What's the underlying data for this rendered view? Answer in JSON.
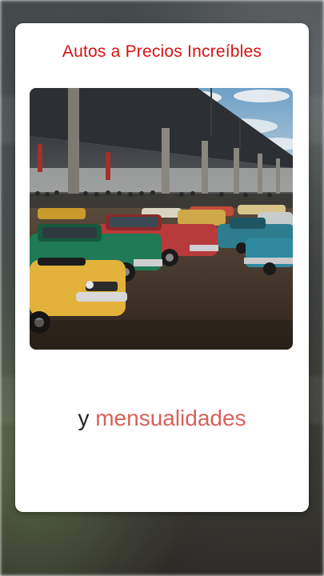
{
  "card": {
    "title": "Autos a Precios Increíbles"
  },
  "tagline": {
    "plain_text": "y ",
    "accent_text": "mensualidades"
  },
  "photo": {
    "subject": "car-lot-photo"
  },
  "colors": {
    "title": "#d71313",
    "accent": "#d9615a",
    "text": "#222222",
    "card": "#ffffff"
  }
}
